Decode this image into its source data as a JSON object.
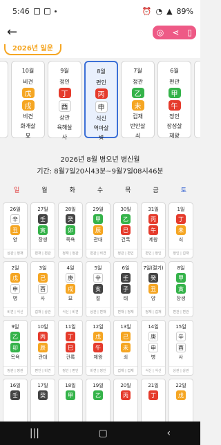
{
  "status": {
    "time": "5:46",
    "battery": "89%"
  },
  "month_cards": [
    {
      "num": "10월",
      "top": "비견",
      "stem": "戊",
      "branch": "戌",
      "bottom": "비견",
      "s1": "화개살",
      "s2": "묘",
      "stemColor": "#f5a623",
      "branchColor": "#f5a623"
    },
    {
      "num": "9월",
      "top": "정인",
      "stem": "丁",
      "branch": "酉",
      "bottom": "상관",
      "s1": "육해살",
      "s2": "사",
      "stemColor": "#e53b2c",
      "branchColor": "#ffffff"
    },
    {
      "num": "8월",
      "top": "편인",
      "stem": "丙",
      "branch": "申",
      "bottom": "식신",
      "s1": "역마살",
      "s2": "병",
      "stemColor": "#e53b2c",
      "branchColor": "#ffffff",
      "selected": true
    },
    {
      "num": "7월",
      "top": "정관",
      "stem": "乙",
      "branch": "未",
      "bottom": "겁재",
      "s1": "반안살",
      "s2": "쇠",
      "stemColor": "#35b34a",
      "branchColor": "#f5a623"
    },
    {
      "num": "6월",
      "top": "편관",
      "stem": "甲",
      "branch": "午",
      "bottom": "정인",
      "s1": "장성살",
      "s2": "제왕",
      "stemColor": "#35b34a",
      "branchColor": "#e53b2c"
    }
  ],
  "title": "2026년 8월 병오년 병신월",
  "period": "기간: 8월7일20시43분~9월7일08시46분",
  "weekdays": [
    "일",
    "월",
    "화",
    "수",
    "목",
    "금",
    "토"
  ],
  "weeks": [
    [
      {
        "d": "26일",
        "s": "辛",
        "b": "丑",
        "h": "양",
        "e": "상관 | 정재",
        "sc": "#ffffff",
        "bc": "#f5a623"
      },
      {
        "d": "27일",
        "s": "壬",
        "b": "寅",
        "h": "장생",
        "e": "편재 | 편관",
        "sc": "#444444",
        "bc": "#35b34a"
      },
      {
        "d": "28일",
        "s": "癸",
        "b": "卯",
        "h": "목욕",
        "e": "정재 | 정관",
        "sc": "#444444",
        "bc": "#35b34a"
      },
      {
        "d": "29일",
        "s": "甲",
        "b": "辰",
        "h": "관대",
        "e": "편관 | 비견",
        "sc": "#35b34a",
        "bc": "#f5a623"
      },
      {
        "d": "30일",
        "s": "乙",
        "b": "巳",
        "h": "건록",
        "e": "정관 | 편인",
        "sc": "#35b34a",
        "bc": "#e53b2c"
      },
      {
        "d": "31일",
        "s": "丙",
        "b": "午",
        "h": "제왕",
        "e": "편인 | 정인",
        "sc": "#e53b2c",
        "bc": "#e53b2c"
      },
      {
        "d": "1일",
        "s": "丁",
        "b": "未",
        "h": "쇠",
        "e": "정인 | 겁재",
        "sc": "#e53b2c",
        "bc": "#f5a623"
      }
    ],
    [
      {
        "d": "2일",
        "s": "戊",
        "b": "申",
        "h": "병",
        "e": "비견 | 식신",
        "sc": "#f5a623",
        "bc": "#ffffff"
      },
      {
        "d": "3일",
        "s": "己",
        "b": "酉",
        "h": "사",
        "e": "겁재 | 상관",
        "sc": "#f5a623",
        "bc": "#ffffff"
      },
      {
        "d": "4일",
        "s": "庚",
        "b": "戌",
        "h": "묘",
        "e": "식신 | 비견",
        "sc": "#ffffff",
        "bc": "#f5a623"
      },
      {
        "d": "5일",
        "s": "辛",
        "b": "亥",
        "h": "절",
        "e": "상관 | 편재",
        "sc": "#ffffff",
        "bc": "#444444"
      },
      {
        "d": "6일",
        "s": "壬",
        "b": "子",
        "h": "태",
        "e": "편재 | 정재",
        "sc": "#444444",
        "bc": "#444444"
      },
      {
        "d": "7일(절기)",
        "s": "癸",
        "b": "丑",
        "h": "양",
        "e": "정재 | 겁재",
        "sc": "#444444",
        "bc": "#f5a623"
      },
      {
        "d": "8일",
        "s": "甲",
        "b": "寅",
        "h": "장생",
        "e": "편관 | 편관",
        "sc": "#35b34a",
        "bc": "#35b34a"
      }
    ],
    [
      {
        "d": "9일",
        "s": "乙",
        "b": "卯",
        "h": "목욕",
        "e": "정관 | 정관",
        "sc": "#35b34a",
        "bc": "#35b34a"
      },
      {
        "d": "10일",
        "s": "丙",
        "b": "辰",
        "h": "관대",
        "e": "편인 | 비견",
        "sc": "#e53b2c",
        "bc": "#f5a623"
      },
      {
        "d": "11일",
        "s": "丁",
        "b": "巳",
        "h": "건록",
        "e": "정인 | 편인",
        "sc": "#e53b2c",
        "bc": "#e53b2c"
      },
      {
        "d": "12일",
        "s": "戊",
        "b": "午",
        "h": "제왕",
        "e": "비견 | 정인",
        "sc": "#f5a623",
        "bc": "#e53b2c"
      },
      {
        "d": "13일",
        "s": "己",
        "b": "未",
        "h": "쇠",
        "e": "겁재 | 겁재",
        "sc": "#f5a623",
        "bc": "#f5a623"
      },
      {
        "d": "14일",
        "s": "庚",
        "b": "申",
        "h": "병",
        "e": "식신 | 식신",
        "sc": "#ffffff",
        "bc": "#ffffff"
      },
      {
        "d": "15일",
        "s": "辛",
        "b": "酉",
        "h": "사",
        "e": "상관 | 상관",
        "sc": "#ffffff",
        "bc": "#ffffff"
      }
    ],
    [
      {
        "d": "16일",
        "s": "壬",
        "b": "",
        "h": "",
        "e": "",
        "sc": "#444444",
        "bc": "#ffffff"
      },
      {
        "d": "17일",
        "s": "癸",
        "b": "",
        "h": "",
        "e": "",
        "sc": "#444444",
        "bc": "#ffffff"
      },
      {
        "d": "18일",
        "s": "甲",
        "b": "",
        "h": "",
        "e": "",
        "sc": "#35b34a",
        "bc": "#ffffff"
      },
      {
        "d": "19일",
        "s": "乙",
        "b": "",
        "h": "",
        "e": "",
        "sc": "#35b34a",
        "bc": "#ffffff"
      },
      {
        "d": "20일",
        "s": "丙",
        "b": "",
        "h": "",
        "e": "",
        "sc": "#e53b2c",
        "bc": "#ffffff"
      },
      {
        "d": "21일",
        "s": "丁",
        "b": "",
        "h": "",
        "e": "",
        "sc": "#e53b2c",
        "bc": "#ffffff"
      },
      {
        "d": "22일",
        "s": "戊",
        "b": "",
        "h": "",
        "e": "",
        "sc": "#f5a623",
        "bc": "#ffffff"
      }
    ]
  ],
  "section_chip": "2026년 일운"
}
